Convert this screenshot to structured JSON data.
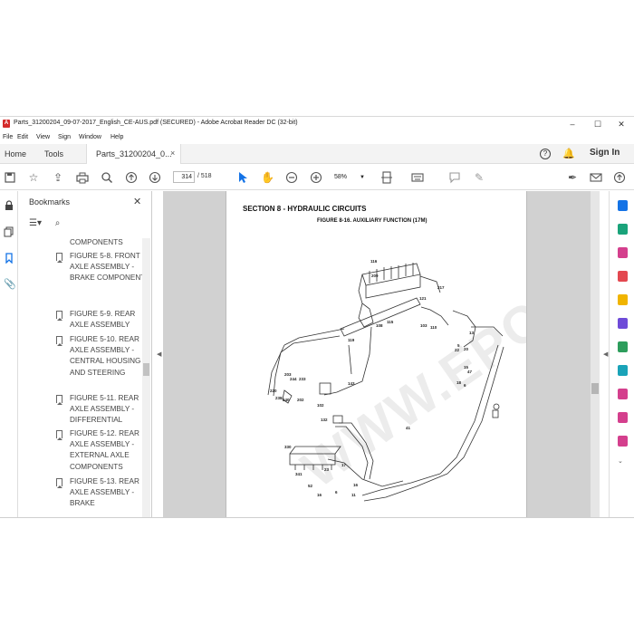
{
  "window": {
    "title": "Parts_31200204_09-07-2017_English_CE-AUS.pdf (SECURED) - Adobe Acrobat Reader DC (32-bit)",
    "minimize": "–",
    "maximize": "☐",
    "close": "✕"
  },
  "menu": [
    "File",
    "Edit",
    "View",
    "Sign",
    "Window",
    "Help"
  ],
  "tabs": {
    "home": "Home",
    "tools": "Tools",
    "document": "Parts_31200204_0...",
    "close": "×",
    "help": "?",
    "sign_in": "Sign In"
  },
  "toolbar": {
    "page_current": "314",
    "page_total": "/ 518",
    "zoom": "58%"
  },
  "bookmarks": {
    "title": "Bookmarks",
    "close": "✕",
    "items": [
      {
        "label": "COMPONENTS",
        "flag": false
      },
      {
        "label": "FIGURE 5-8. FRONT AXLE ASSEMBLY - BRAKE COMPONENTS",
        "flag": true
      },
      {
        "label": "FIGURE 5-9. REAR AXLE ASSEMBLY",
        "flag": true
      },
      {
        "label": "FIGURE 5-10. REAR AXLE ASSEMBLY - CENTRAL HOUSING AND STEERING",
        "flag": true
      },
      {
        "label": "FIGURE 5-11. REAR AXLE ASSEMBLY - DIFFERENTIAL",
        "flag": true
      },
      {
        "label": "FIGURE 5-12. REAR AXLE ASSEMBLY - EXTERNAL AXLE COMPONENTS",
        "flag": true
      },
      {
        "label": "FIGURE 5-13. REAR AXLE ASSEMBLY - BRAKE",
        "flag": true
      }
    ]
  },
  "document": {
    "section_title": "SECTION 8 - HYDRAULIC CIRCUITS",
    "figure_title": "FIGURE 8-16. AUXILIARY FUNCTION (17M)",
    "watermark": "WWW.EPCSO.COM",
    "callouts": [
      "116",
      "209",
      "217",
      "121",
      "110",
      "108",
      "115",
      "103",
      "119",
      "143",
      "203",
      "244",
      "233",
      "220",
      "238",
      "240",
      "202",
      "102",
      "132",
      "330",
      "341",
      "41",
      "23",
      "17",
      "52",
      "16",
      "6",
      "11",
      "16",
      "15",
      "47",
      "18",
      "6",
      "13",
      "20",
      "22",
      "5"
    ]
  },
  "colors": {
    "accent_blue": "#1473e6",
    "tab_bg": "#f3f3f3",
    "doc_bg": "#d1d1d1"
  }
}
